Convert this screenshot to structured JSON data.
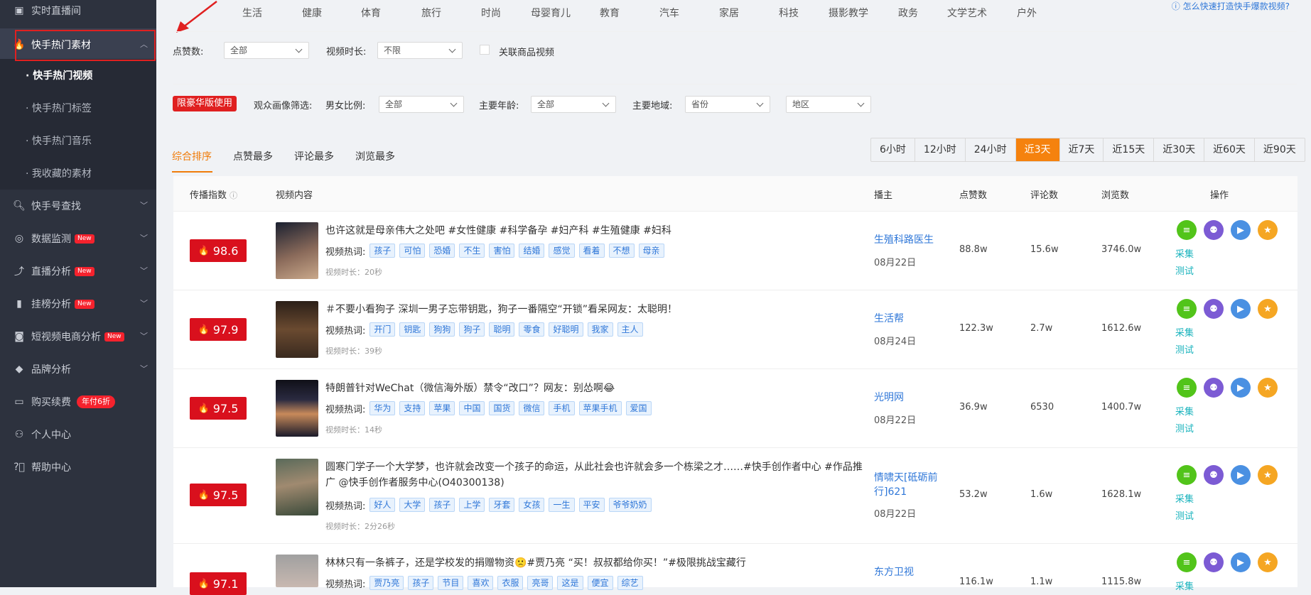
{
  "sidebar": {
    "items": [
      {
        "label": "实时直播间",
        "icon": "calendar-icon"
      },
      {
        "label": "快手热门素材",
        "icon": "fire-icon"
      },
      {
        "label": "快手号查找",
        "icon": "search-icon"
      },
      {
        "label": "数据监测",
        "icon": "monitor-icon",
        "badge": "New"
      },
      {
        "label": "直播分析",
        "icon": "trend-icon",
        "badge": "New"
      },
      {
        "label": "挂榜分析",
        "icon": "bar-icon",
        "badge": "New"
      },
      {
        "label": "短视频电商分析",
        "icon": "bag-icon",
        "badge": "New"
      },
      {
        "label": "品牌分析",
        "icon": "diamond-icon"
      },
      {
        "label": "购买续费",
        "icon": "card-icon",
        "badge": "年付6折"
      },
      {
        "label": "个人中心",
        "icon": "user-icon"
      },
      {
        "label": "帮助中心",
        "icon": "help-icon"
      }
    ],
    "sub_items": [
      "· 快手热门视频",
      "· 快手热门标签",
      "· 快手热门音乐",
      "· 我收藏的素材"
    ]
  },
  "categories": [
    "生活",
    "健康",
    "体育",
    "旅行",
    "时尚",
    "母婴育儿",
    "教育",
    "汽车",
    "家居",
    "科技",
    "摄影教学",
    "政务",
    "文学艺术",
    "户外"
  ],
  "help_link": "怎么快速打造快手爆款视频?",
  "filters": {
    "likes_label": "点赞数:",
    "likes_value": "全部",
    "duration_label": "视频时长:",
    "duration_value": "不限",
    "product_label": "关联商品视频",
    "luxury_badge": "限豪华版使用",
    "audience_label": "观众画像筛选:",
    "gender_label": "男女比例:",
    "gender_value": "全部",
    "age_label": "主要年龄:",
    "age_value": "全部",
    "region_label": "主要地域:",
    "province_value": "省份",
    "area_value": "地区"
  },
  "sort_tabs": [
    "综合排序",
    "点赞最多",
    "评论最多",
    "浏览最多"
  ],
  "time_ranges": [
    "6小时",
    "12小时",
    "24小时",
    "近3天",
    "近7天",
    "近15天",
    "近30天",
    "近60天",
    "近90天"
  ],
  "active_time": 3,
  "table": {
    "headers": [
      "传播指数",
      "视频内容",
      "播主",
      "点赞数",
      "评论数",
      "浏览数",
      "操作"
    ],
    "tag_label": "视频热词:",
    "collect_label": "采集",
    "test_label": "测试",
    "rows": [
      {
        "score": "98.6",
        "title": "也许这就是母亲伟大之处吧 #女性健康 #科学备孕 #妇产科 #生殖健康 #妇科",
        "tags": [
          "孩子",
          "可怕",
          "恐婚",
          "不生",
          "害怕",
          "结婚",
          "感觉",
          "看着",
          "不想",
          "母亲"
        ],
        "duration": "视频时长：20秒",
        "author": "生殖科路医生",
        "date": "08月22日",
        "likes": "88.8w",
        "comments": "15.6w",
        "views": "3746.0w"
      },
      {
        "score": "97.9",
        "title": "＃不要小看狗子 深圳一男子忘带钥匙，狗子一番隔空“开锁”看呆网友：太聪明！",
        "tags": [
          "开门",
          "钥匙",
          "狗狗",
          "狗子",
          "聪明",
          "零食",
          "好聪明",
          "我家",
          "主人"
        ],
        "duration": "视频时长：39秒",
        "author": "生活帮",
        "date": "08月24日",
        "likes": "122.3w",
        "comments": "2.7w",
        "views": "1612.6w"
      },
      {
        "score": "97.5",
        "title": "特朗普针对WeChat（微信海外版）禁令“改口”？网友：别怂啊😂",
        "tags": [
          "华为",
          "支持",
          "苹果",
          "中国",
          "国货",
          "微信",
          "手机",
          "苹果手机",
          "爱国"
        ],
        "duration": "视频时长：14秒",
        "author": "光明网",
        "date": "08月22日",
        "likes": "36.9w",
        "comments": "6530",
        "views": "1400.7w"
      },
      {
        "score": "97.5",
        "title": "圆寒门学子一个大学梦，也许就会改变一个孩子的命运，从此社会也许就会多一个栋梁之才……#快手创作者中心 #作品推广 @快手创作者服务中心(O40300138)",
        "tags": [
          "好人",
          "大学",
          "孩子",
          "上学",
          "牙套",
          "女孩",
          "一生",
          "平安",
          "爷爷奶奶"
        ],
        "duration": "视频时长：2分26秒",
        "author": "情啸天[砥砺前行]621",
        "date": "08月22日",
        "likes": "53.2w",
        "comments": "1.6w",
        "views": "1628.1w"
      },
      {
        "score": "97.1",
        "title": "林林只有一条裤子，还是学校发的捐赠物资🙁#贾乃亮 “买！叔叔都给你买！”#极限挑战宝藏行",
        "tags": [
          "贾乃亮",
          "孩子",
          "节目",
          "喜欢",
          "衣服",
          "亮哥",
          "这是",
          "便宜",
          "综艺"
        ],
        "duration": "",
        "author": "东方卫视",
        "date": "",
        "likes": "116.1w",
        "comments": "1.1w",
        "views": "1115.8w"
      }
    ]
  }
}
